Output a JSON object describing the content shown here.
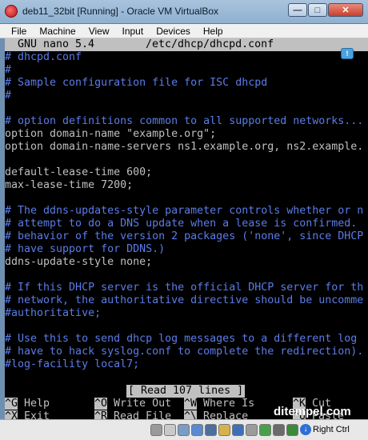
{
  "window": {
    "title": "deb11_32bit [Running] - Oracle VM VirtualBox",
    "minimize": "—",
    "maximize": "□",
    "close": "✕"
  },
  "menu": [
    "File",
    "Machine",
    "View",
    "Input",
    "Devices",
    "Help"
  ],
  "nano": {
    "title": "GNU nano 5.4",
    "file": "/etc/dhcp/dhcpd.conf",
    "status": "[ Read 107 lines ]"
  },
  "lines": [
    {
      "text": "# dhcpd.conf",
      "comment": true
    },
    {
      "text": "#",
      "comment": true
    },
    {
      "text": "# Sample configuration file for ISC dhcpd",
      "comment": true
    },
    {
      "text": "#",
      "comment": true
    },
    {
      "text": "",
      "comment": false
    },
    {
      "text": "# option definitions common to all supported networks...",
      "comment": true
    },
    {
      "text": "option domain-name \"example.org\";",
      "comment": false
    },
    {
      "text": "option domain-name-servers ns1.example.org, ns2.example.",
      "comment": false
    },
    {
      "text": "",
      "comment": false
    },
    {
      "text": "default-lease-time 600;",
      "comment": false
    },
    {
      "text": "max-lease-time 7200;",
      "comment": false
    },
    {
      "text": "",
      "comment": false
    },
    {
      "text": "# The ddns-updates-style parameter controls whether or n",
      "comment": true
    },
    {
      "text": "# attempt to do a DNS update when a lease is confirmed.",
      "comment": true
    },
    {
      "text": "# behavior of the version 2 packages ('none', since DHCP",
      "comment": true
    },
    {
      "text": "# have support for DDNS.)",
      "comment": true
    },
    {
      "text": "ddns-update-style none;",
      "comment": false
    },
    {
      "text": "",
      "comment": false
    },
    {
      "text": "# If this DHCP server is the official DHCP server for th",
      "comment": true
    },
    {
      "text": "# network, the authoritative directive should be uncomme",
      "comment": true
    },
    {
      "text": "#authoritative;",
      "comment": true
    },
    {
      "text": "",
      "comment": false
    },
    {
      "text": "# Use this to send dhcp log messages to a different log",
      "comment": true
    },
    {
      "text": "# have to hack syslog.conf to complete the redirection).",
      "comment": true
    },
    {
      "text": "#log-facility local7;",
      "comment": true
    }
  ],
  "shortcuts": [
    {
      "key": "^G",
      "label": "Help",
      "row": 0,
      "col": 0
    },
    {
      "key": "^O",
      "label": "Write Out",
      "row": 0,
      "col": 1
    },
    {
      "key": "^W",
      "label": "Where Is",
      "row": 0,
      "col": 2
    },
    {
      "key": "^K",
      "label": "Cut",
      "row": 0,
      "col": 3
    },
    {
      "key": "^X",
      "label": "Exit",
      "row": 1,
      "col": 0
    },
    {
      "key": "^R",
      "label": "Read File",
      "row": 1,
      "col": 1
    },
    {
      "key": "^\\",
      "label": "Replace",
      "row": 1,
      "col": 2
    },
    {
      "key": "^U",
      "label": "Paste",
      "row": 1,
      "col": 3
    }
  ],
  "watermark": "ditempel.com",
  "statusbar": {
    "host_key": "Right Ctrl",
    "icons": [
      {
        "name": "hard-disk-icon",
        "color": "#9a9a9a"
      },
      {
        "name": "optical-drive-icon",
        "color": "#c9c9c9"
      },
      {
        "name": "audio-icon",
        "color": "#7a9cc6"
      },
      {
        "name": "network-icon",
        "color": "#5a8ad0"
      },
      {
        "name": "usb-icon",
        "color": "#4d6f9e"
      },
      {
        "name": "shared-folders-icon",
        "color": "#d6b24a"
      },
      {
        "name": "display-icon",
        "color": "#3f6fb5"
      },
      {
        "name": "video-capture-icon",
        "color": "#9b9b9b"
      },
      {
        "name": "mouse-integration-icon",
        "color": "#4aa04a"
      },
      {
        "name": "cpu-icon",
        "color": "#6b6b6b"
      },
      {
        "name": "guest-additions-icon",
        "color": "#3b8a3b"
      }
    ]
  }
}
